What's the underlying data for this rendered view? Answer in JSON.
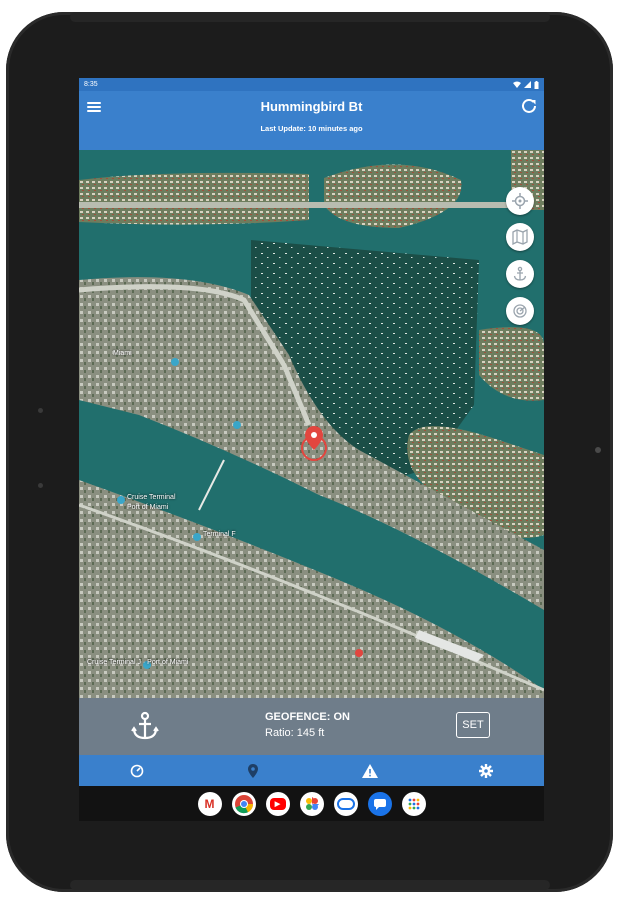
{
  "status_bar": {
    "time": "8:35"
  },
  "app": {
    "title": "Hummingbird Bt",
    "subtitle": "Last Update: 10 minutes ago"
  },
  "map": {
    "labels": {
      "poi_1": "Miami",
      "poi_2": "Cruise Terminal",
      "poi_3": "Port of Miami",
      "poi_4": "Terminal F",
      "poi_5": "Cruise Terminal J · Port of Miami"
    }
  },
  "geofence": {
    "status": "GEOFENCE: ON",
    "ratio": "Ratio: 145 ft",
    "set_label": "SET"
  },
  "bottom_nav": {
    "items": [
      {
        "icon": "gauge-icon"
      },
      {
        "icon": "location-pin-icon"
      },
      {
        "icon": "warning-icon"
      },
      {
        "icon": "gear-icon"
      }
    ]
  },
  "dock": {
    "apps": [
      {
        "icon": "gmail-icon",
        "glyph": "M"
      },
      {
        "icon": "chrome-icon",
        "glyph": ""
      },
      {
        "icon": "youtube-icon",
        "glyph": "▶"
      },
      {
        "icon": "photos-icon",
        "glyph": ""
      },
      {
        "icon": "duo-icon",
        "glyph": ""
      },
      {
        "icon": "messages-icon",
        "glyph": ""
      },
      {
        "icon": "app-drawer-icon",
        "glyph": ""
      }
    ]
  },
  "colors": {
    "appbar": "#3a80cc",
    "statusbar": "#2f73c0",
    "geofence_bar": "#6f7d8a",
    "water": "#1f6f6c",
    "marker": "#e2463f"
  }
}
